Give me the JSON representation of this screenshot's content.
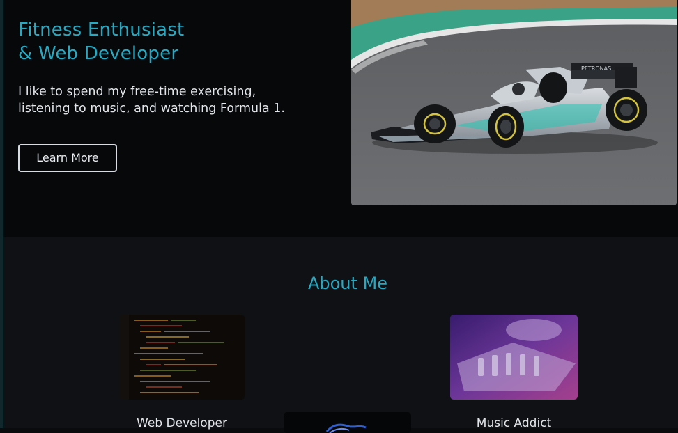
{
  "hero": {
    "title_line1": "Fitness Enthusiast",
    "title_line2": "& Web Developer",
    "text_line1": "I like to spend my free-time exercising,",
    "text_line2": "listening to music, and watching Formula 1.",
    "button_label": "Learn More",
    "photo_alt": "Formula 1 race car on track"
  },
  "about": {
    "title": "About Me",
    "cards": [
      {
        "label": "Web Developer",
        "image": "code-screen"
      },
      {
        "label": "",
        "image": "blue-graphic"
      },
      {
        "label": "Music Addict",
        "image": "mixing-console"
      }
    ]
  },
  "colors": {
    "accent": "#27a9c2",
    "hero_bg": "#07080a",
    "section_bg": "#0f1115",
    "text": "#e2e5ea"
  }
}
